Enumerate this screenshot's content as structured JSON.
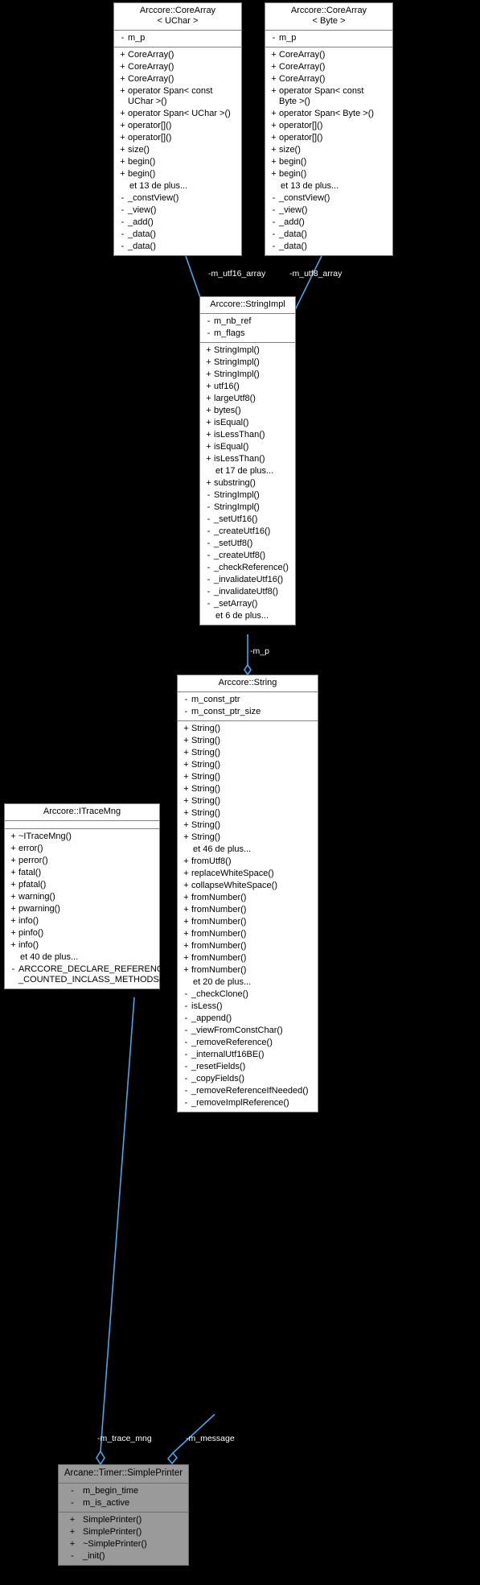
{
  "diagram": {
    "kind": "uml-class-collaboration-diagram",
    "background": "#000000",
    "edge_color": "#4ba6e8",
    "highlight_color": "#9a9a9a",
    "box_border_color": "#808080",
    "more_suffix": "de plus..."
  },
  "classes": {
    "corearray_uchar": {
      "title": "Arccore::CoreArray\n< UChar >",
      "attributes": [
        {
          "vis": "-",
          "name": "m_p"
        }
      ],
      "operations": [
        {
          "vis": "+",
          "name": "CoreArray()"
        },
        {
          "vis": "+",
          "name": "CoreArray()"
        },
        {
          "vis": "+",
          "name": "CoreArray()"
        },
        {
          "vis": "+",
          "name": "operator Span< const\nUChar >()"
        },
        {
          "vis": "+",
          "name": "operator Span< UChar >()"
        },
        {
          "vis": "+",
          "name": "operator[]()"
        },
        {
          "vis": "+",
          "name": "operator[]()"
        },
        {
          "vis": "+",
          "name": "size()"
        },
        {
          "vis": "+",
          "name": "begin()"
        },
        {
          "vis": "+",
          "name": "begin()"
        },
        {
          "vis": "",
          "name": "et 13 de plus...",
          "more": true
        },
        {
          "vis": "-",
          "name": "_constView()"
        },
        {
          "vis": "-",
          "name": "_view()"
        },
        {
          "vis": "-",
          "name": "_add()"
        },
        {
          "vis": "-",
          "name": "_data()"
        },
        {
          "vis": "-",
          "name": "_data()"
        }
      ]
    },
    "corearray_byte": {
      "title": "Arccore::CoreArray\n< Byte >",
      "attributes": [
        {
          "vis": "-",
          "name": "m_p"
        }
      ],
      "operations": [
        {
          "vis": "+",
          "name": "CoreArray()"
        },
        {
          "vis": "+",
          "name": "CoreArray()"
        },
        {
          "vis": "+",
          "name": "CoreArray()"
        },
        {
          "vis": "+",
          "name": "operator Span< const\nByte >()"
        },
        {
          "vis": "+",
          "name": "operator Span< Byte >()"
        },
        {
          "vis": "+",
          "name": "operator[]()"
        },
        {
          "vis": "+",
          "name": "operator[]()"
        },
        {
          "vis": "+",
          "name": "size()"
        },
        {
          "vis": "+",
          "name": "begin()"
        },
        {
          "vis": "+",
          "name": "begin()"
        },
        {
          "vis": "",
          "name": "et 13 de plus...",
          "more": true
        },
        {
          "vis": "-",
          "name": "_constView()"
        },
        {
          "vis": "-",
          "name": "_view()"
        },
        {
          "vis": "-",
          "name": "_add()"
        },
        {
          "vis": "-",
          "name": "_data()"
        },
        {
          "vis": "-",
          "name": "_data()"
        }
      ]
    },
    "stringimpl": {
      "title": "Arccore::StringImpl",
      "attributes": [
        {
          "vis": "-",
          "name": "m_nb_ref"
        },
        {
          "vis": "-",
          "name": "m_flags"
        }
      ],
      "operations": [
        {
          "vis": "+",
          "name": "StringImpl()"
        },
        {
          "vis": "+",
          "name": "StringImpl()"
        },
        {
          "vis": "+",
          "name": "StringImpl()"
        },
        {
          "vis": "+",
          "name": "utf16()"
        },
        {
          "vis": "+",
          "name": "largeUtf8()"
        },
        {
          "vis": "+",
          "name": "bytes()"
        },
        {
          "vis": "+",
          "name": "isEqual()"
        },
        {
          "vis": "+",
          "name": "isLessThan()"
        },
        {
          "vis": "+",
          "name": "isEqual()"
        },
        {
          "vis": "+",
          "name": "isLessThan()"
        },
        {
          "vis": "",
          "name": "et 17 de plus...",
          "more": true
        },
        {
          "vis": "+",
          "name": "substring()"
        },
        {
          "vis": "-",
          "name": "StringImpl()"
        },
        {
          "vis": "-",
          "name": "StringImpl()"
        },
        {
          "vis": "-",
          "name": "_setUtf16()"
        },
        {
          "vis": "-",
          "name": "_createUtf16()"
        },
        {
          "vis": "-",
          "name": "_setUtf8()"
        },
        {
          "vis": "-",
          "name": "_createUtf8()"
        },
        {
          "vis": "-",
          "name": "_checkReference()"
        },
        {
          "vis": "-",
          "name": "_invalidateUtf16()"
        },
        {
          "vis": "-",
          "name": "_invalidateUtf8()"
        },
        {
          "vis": "-",
          "name": "_setArray()"
        },
        {
          "vis": "",
          "name": "et 6 de plus...",
          "more": true
        }
      ]
    },
    "string": {
      "title": "Arccore::String",
      "attributes": [
        {
          "vis": "-",
          "name": "m_const_ptr"
        },
        {
          "vis": "-",
          "name": "m_const_ptr_size"
        }
      ],
      "operations": [
        {
          "vis": "+",
          "name": "String()"
        },
        {
          "vis": "+",
          "name": "String()"
        },
        {
          "vis": "+",
          "name": "String()"
        },
        {
          "vis": "+",
          "name": "String()"
        },
        {
          "vis": "+",
          "name": "String()"
        },
        {
          "vis": "+",
          "name": "String()"
        },
        {
          "vis": "+",
          "name": "String()"
        },
        {
          "vis": "+",
          "name": "String()"
        },
        {
          "vis": "+",
          "name": "String()"
        },
        {
          "vis": "+",
          "name": "String()"
        },
        {
          "vis": "",
          "name": "et 46 de plus...",
          "more": true
        },
        {
          "vis": "+",
          "name": "fromUtf8()"
        },
        {
          "vis": "+",
          "name": "replaceWhiteSpace()"
        },
        {
          "vis": "+",
          "name": "collapseWhiteSpace()"
        },
        {
          "vis": "+",
          "name": "fromNumber()"
        },
        {
          "vis": "+",
          "name": "fromNumber()"
        },
        {
          "vis": "+",
          "name": "fromNumber()"
        },
        {
          "vis": "+",
          "name": "fromNumber()"
        },
        {
          "vis": "+",
          "name": "fromNumber()"
        },
        {
          "vis": "+",
          "name": "fromNumber()"
        },
        {
          "vis": "+",
          "name": "fromNumber()"
        },
        {
          "vis": "",
          "name": "et 20 de plus...",
          "more": true
        },
        {
          "vis": "-",
          "name": "_checkClone()"
        },
        {
          "vis": "-",
          "name": "isLess()"
        },
        {
          "vis": "-",
          "name": "_append()"
        },
        {
          "vis": "-",
          "name": "_viewFromConstChar()"
        },
        {
          "vis": "-",
          "name": "_removeReference()"
        },
        {
          "vis": "-",
          "name": "_internalUtf16BE()"
        },
        {
          "vis": "-",
          "name": "_resetFields()"
        },
        {
          "vis": "-",
          "name": "_copyFields()"
        },
        {
          "vis": "-",
          "name": "_removeReferenceIfNeeded()"
        },
        {
          "vis": "-",
          "name": "_removeImplReference()"
        }
      ]
    },
    "itracemng": {
      "title": "Arccore::ITraceMng",
      "attributes": [],
      "operations": [
        {
          "vis": "+",
          "name": "~ITraceMng()"
        },
        {
          "vis": "+",
          "name": "error()"
        },
        {
          "vis": "+",
          "name": "perror()"
        },
        {
          "vis": "+",
          "name": "fatal()"
        },
        {
          "vis": "+",
          "name": "pfatal()"
        },
        {
          "vis": "+",
          "name": "warning()"
        },
        {
          "vis": "+",
          "name": "pwarning()"
        },
        {
          "vis": "+",
          "name": "info()"
        },
        {
          "vis": "+",
          "name": "pinfo()"
        },
        {
          "vis": "+",
          "name": "info()"
        },
        {
          "vis": "",
          "name": "et 40 de plus...",
          "more": true
        },
        {
          "vis": "-",
          "name": "ARCCORE_DECLARE_REFERENCE\n_COUNTED_INCLASS_METHODS()",
          "wrap": true
        }
      ]
    },
    "simpleprinter": {
      "title": "Arcane::Timer::SimplePrinter",
      "highlighted": true,
      "attributes": [
        {
          "vis": "-",
          "name": "m_begin_time"
        },
        {
          "vis": "-",
          "name": "m_is_active"
        }
      ],
      "operations": [
        {
          "vis": "+",
          "name": "SimplePrinter()"
        },
        {
          "vis": "+",
          "name": "SimplePrinter()"
        },
        {
          "vis": "+",
          "name": "~SimplePrinter()"
        },
        {
          "vis": "-",
          "name": "_init()"
        }
      ]
    }
  },
  "edge_labels": {
    "utf16_array": "-m_utf16_array",
    "utf8_array": "-m_utf8_array",
    "m_p": "-m_p",
    "trace_mng": "-m_trace_mng",
    "message": "-m_message"
  }
}
